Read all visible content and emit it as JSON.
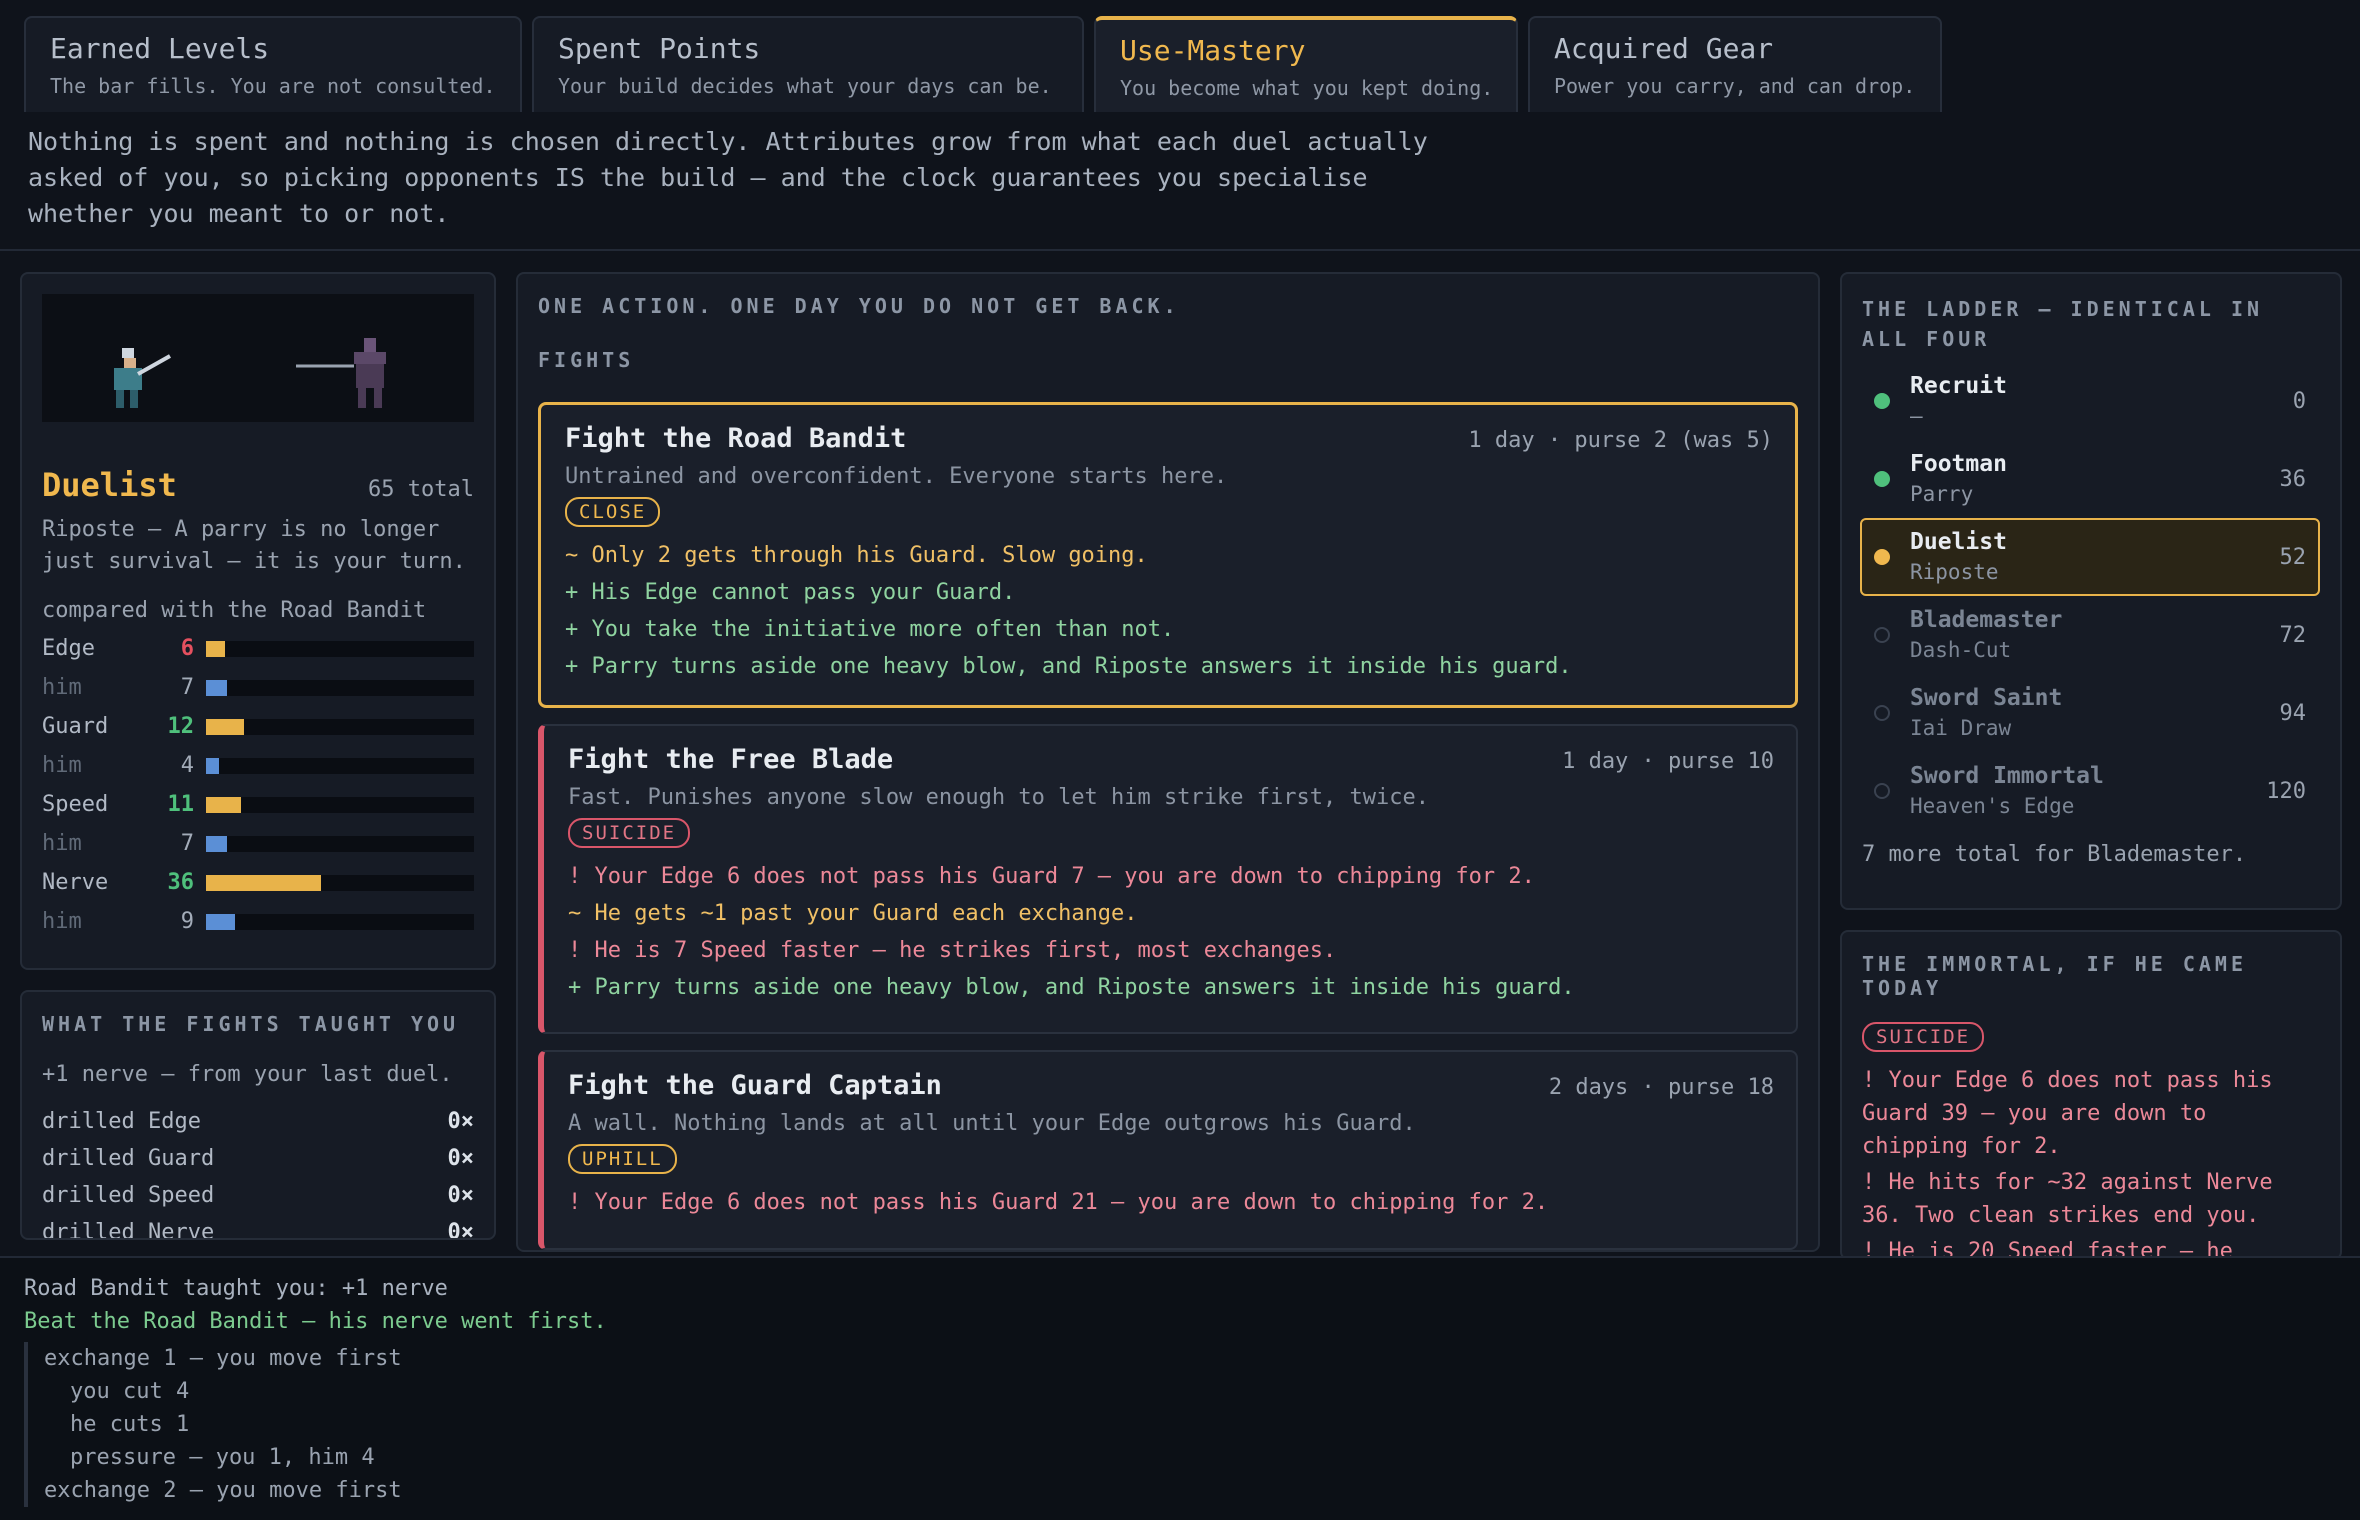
{
  "tabs": [
    {
      "title": "Earned Levels",
      "sub": "The bar fills. You are not consulted."
    },
    {
      "title": "Spent Points",
      "sub": "Your build decides what your days can be."
    },
    {
      "title": "Use-Mastery",
      "sub": "You become what you kept doing."
    },
    {
      "title": "Acquired Gear",
      "sub": "Power you carry, and can drop."
    }
  ],
  "intro": "Nothing is spent and nothing is chosen directly. Attributes grow from what each duel actually asked of you, so picking opponents IS the build — and the clock guarantees you specialise whether you meant to or not.",
  "character": {
    "rank": "Duelist",
    "total": "65 total",
    "desc": "Riposte — A parry is no longer just survival — it is your turn.",
    "compare": "compared with the Road Bandit",
    "stats": [
      {
        "label": "Edge",
        "val": "6",
        "fill": 0.07,
        "color": "#e5505f",
        "him": false
      },
      {
        "label": "him",
        "val": "7",
        "fill": 0.08,
        "him": true
      },
      {
        "label": "Guard",
        "val": "12",
        "fill": 0.14,
        "color": "#4fc07c",
        "him": false
      },
      {
        "label": "him",
        "val": "4",
        "fill": 0.05,
        "him": true
      },
      {
        "label": "Speed",
        "val": "11",
        "fill": 0.13,
        "color": "#4fc07c",
        "him": false
      },
      {
        "label": "him",
        "val": "7",
        "fill": 0.08,
        "him": true
      },
      {
        "label": "Nerve",
        "val": "36",
        "fill": 0.43,
        "color": "#4fc07c",
        "him": false
      },
      {
        "label": "him",
        "val": "9",
        "fill": 0.11,
        "him": true
      }
    ]
  },
  "taught": {
    "head": "WHAT THE FIGHTS TAUGHT YOU",
    "note": "+1 nerve — from your last duel.",
    "drills": [
      {
        "label": "drilled Edge",
        "count": "0×"
      },
      {
        "label": "drilled Guard",
        "count": "0×"
      },
      {
        "label": "drilled Speed",
        "count": "0×"
      },
      {
        "label": "drilled Nerve",
        "count": "0×"
      }
    ]
  },
  "fights": {
    "head": "ONE ACTION. ONE DAY YOU DO NOT GET BACK.",
    "sub": "FIGHTS",
    "items": [
      {
        "name": "Fight the Road Bandit",
        "meta": "1 day · purse 2 (was 5)",
        "desc": "Untrained and overconfident. Everyone starts here.",
        "tag": "CLOSE",
        "lines": [
          {
            "t": "~ Only 2 gets through his Guard. Slow going.",
            "c": "y"
          },
          {
            "t": "+ His Edge cannot pass your Guard.",
            "c": "g"
          },
          {
            "t": "+ You take the initiative more often than not.",
            "c": "g"
          },
          {
            "t": "+ Parry turns aside one heavy blow, and Riposte answers it inside his guard.",
            "c": "g"
          }
        ]
      },
      {
        "name": "Fight the Free Blade",
        "meta": "1 day · purse 10",
        "desc": "Fast. Punishes anyone slow enough to let him strike first, twice.",
        "tag": "SUICIDE",
        "lines": [
          {
            "t": "! Your Edge 6 does not pass his Guard 7 — you are down to chipping for 2.",
            "c": "r"
          },
          {
            "t": "~ He gets ~1 past your Guard each exchange.",
            "c": "y"
          },
          {
            "t": "! He is 7 Speed faster — he strikes first, most exchanges.",
            "c": "r"
          },
          {
            "t": "+ Parry turns aside one heavy blow, and Riposte answers it inside his guard.",
            "c": "g"
          }
        ]
      },
      {
        "name": "Fight the Guard Captain",
        "meta": "2 days · purse 18",
        "desc": "A wall. Nothing lands at all until your Edge outgrows his Guard.",
        "tag": "UPHILL",
        "lines": [
          {
            "t": "! Your Edge 6 does not pass his Guard 21 — you are down to chipping for 2.",
            "c": "r"
          }
        ]
      }
    ]
  },
  "ladder": {
    "head": "THE LADDER — IDENTICAL IN ALL FOUR",
    "rungs": [
      {
        "name": "Recruit",
        "sub": "—",
        "val": "0",
        "state": "done"
      },
      {
        "name": "Footman",
        "sub": "Parry",
        "val": "36",
        "state": "done"
      },
      {
        "name": "Duelist",
        "sub": "Riposte",
        "val": "52",
        "state": "cur"
      },
      {
        "name": "Blademaster",
        "sub": "Dash-Cut",
        "val": "72",
        "state": "todo"
      },
      {
        "name": "Sword Saint",
        "sub": "Iai Draw",
        "val": "94",
        "state": "todo"
      },
      {
        "name": "Sword Immortal",
        "sub": "Heaven's Edge",
        "val": "120",
        "state": "todo"
      }
    ],
    "foot": "7 more total for Blademaster."
  },
  "immortal": {
    "head": "THE IMMORTAL, IF HE CAME TODAY",
    "tag": "SUICIDE",
    "lines": [
      "! Your Edge 6 does not pass his Guard 39 — you are down to chipping for 2.",
      "! He hits for ~32 against Nerve 36. Two clean strikes end you.",
      "! He is 20 Speed faster — he"
    ]
  },
  "log": {
    "first": "Road Bandit taught you: +1 nerve",
    "win": "Beat the Road Bandit — his nerve went first.",
    "block": [
      {
        "t": "exchange 1 — you move first",
        "indent": false
      },
      {
        "t": "you cut 4",
        "indent": true
      },
      {
        "t": "he cuts 1",
        "indent": true
      },
      {
        "t": "pressure — you 1, him 4",
        "indent": true
      },
      {
        "t": "exchange 2 — you move first",
        "indent": false
      }
    ]
  }
}
